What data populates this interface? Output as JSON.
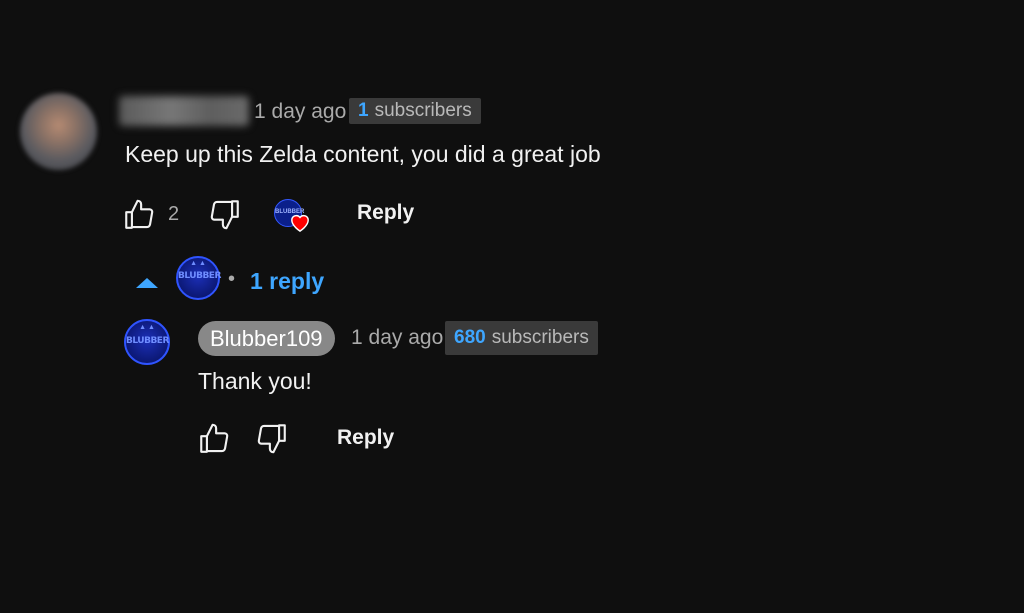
{
  "comment": {
    "time": "1 day ago",
    "subscribers_num": "1",
    "subscribers_label": "subscribers",
    "text": "Keep up this Zelda content, you did a great job",
    "likes": "2",
    "reply_label": "Reply",
    "hearted_by_creator": true
  },
  "replies_toggle": {
    "label": "1 reply"
  },
  "reply": {
    "author": "Blubber109",
    "time": "1 day ago",
    "subscribers_num": "680",
    "subscribers_label": "subscribers",
    "text": "Thank you!",
    "reply_label": "Reply"
  },
  "channel_logo": {
    "text": "BLUBBER",
    "color": "#2f54ff"
  },
  "colors": {
    "background": "#0f0f0f",
    "accent": "#3ea6ff",
    "heart": "#ff0000"
  }
}
